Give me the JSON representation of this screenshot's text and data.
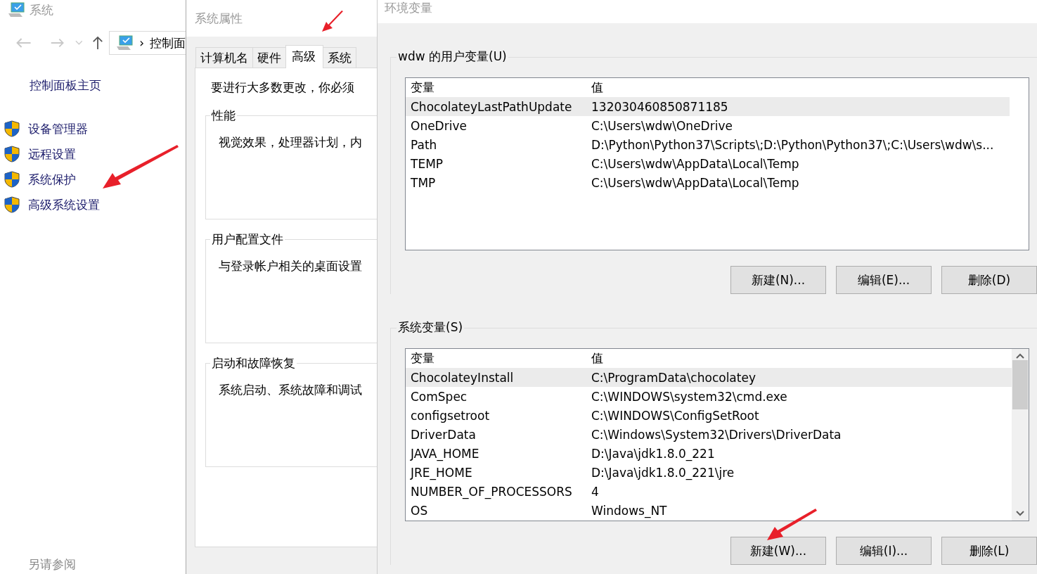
{
  "system_window": {
    "title": "系统",
    "address": {
      "separator": "›",
      "path": "控制面"
    },
    "home_link": "控制面板主页",
    "links": [
      {
        "label": "设备管理器"
      },
      {
        "label": "远程设置"
      },
      {
        "label": "系统保护"
      },
      {
        "label": "高级系统设置"
      }
    ],
    "see_also": "另请参阅"
  },
  "properties_window": {
    "title": "系统属性",
    "tabs": [
      {
        "label": "计算机名",
        "selected": false
      },
      {
        "label": "硬件",
        "selected": false
      },
      {
        "label": "高级",
        "selected": true
      },
      {
        "label": "系统",
        "selected": false
      }
    ],
    "intro": "要进行大多数更改，你必须",
    "groups": [
      {
        "title": "性能",
        "text": "视觉效果，处理器计划，内"
      },
      {
        "title": "用户配置文件",
        "text": "与登录帐户相关的桌面设置"
      },
      {
        "title": "启动和故障恢复",
        "text": "系统启动、系统故障和调试"
      }
    ]
  },
  "env_window": {
    "title": "环境变量",
    "user_vars": {
      "title": "wdw 的用户变量(U)",
      "columns": [
        "变量",
        "值"
      ],
      "scrollbar": false,
      "rows": [
        {
          "name": "ChocolateyLastPathUpdate",
          "value": "132030460850871185",
          "selected": true
        },
        {
          "name": "OneDrive",
          "value": "C:\\Users\\wdw\\OneDrive",
          "selected": false
        },
        {
          "name": "Path",
          "value": "D:\\Python\\Python37\\Scripts\\;D:\\Python\\Python37\\;C:\\Users\\wdw\\s...",
          "selected": false
        },
        {
          "name": "TEMP",
          "value": "C:\\Users\\wdw\\AppData\\Local\\Temp",
          "selected": false
        },
        {
          "name": "TMP",
          "value": "C:\\Users\\wdw\\AppData\\Local\\Temp",
          "selected": false
        }
      ],
      "buttons": [
        "新建(N)...",
        "编辑(E)...",
        "删除(D)"
      ]
    },
    "system_vars": {
      "title": "系统变量(S)",
      "columns": [
        "变量",
        "值"
      ],
      "scrollbar": true,
      "rows": [
        {
          "name": "ChocolateyInstall",
          "value": "C:\\ProgramData\\chocolatey",
          "selected": true
        },
        {
          "name": "ComSpec",
          "value": "C:\\WINDOWS\\system32\\cmd.exe",
          "selected": false
        },
        {
          "name": "configsetroot",
          "value": "C:\\WINDOWS\\ConfigSetRoot",
          "selected": false
        },
        {
          "name": "DriverData",
          "value": "C:\\Windows\\System32\\Drivers\\DriverData",
          "selected": false
        },
        {
          "name": "JAVA_HOME",
          "value": "D:\\Java\\jdk1.8.0_221",
          "selected": false
        },
        {
          "name": "JRE_HOME",
          "value": "D:\\Java\\jdk1.8.0_221\\jre",
          "selected": false
        },
        {
          "name": "NUMBER_OF_PROCESSORS",
          "value": "4",
          "selected": false
        },
        {
          "name": "OS",
          "value": "Windows_NT",
          "selected": false
        }
      ],
      "buttons": [
        "新建(W)...",
        "编辑(I)...",
        "删除(L)"
      ]
    }
  }
}
